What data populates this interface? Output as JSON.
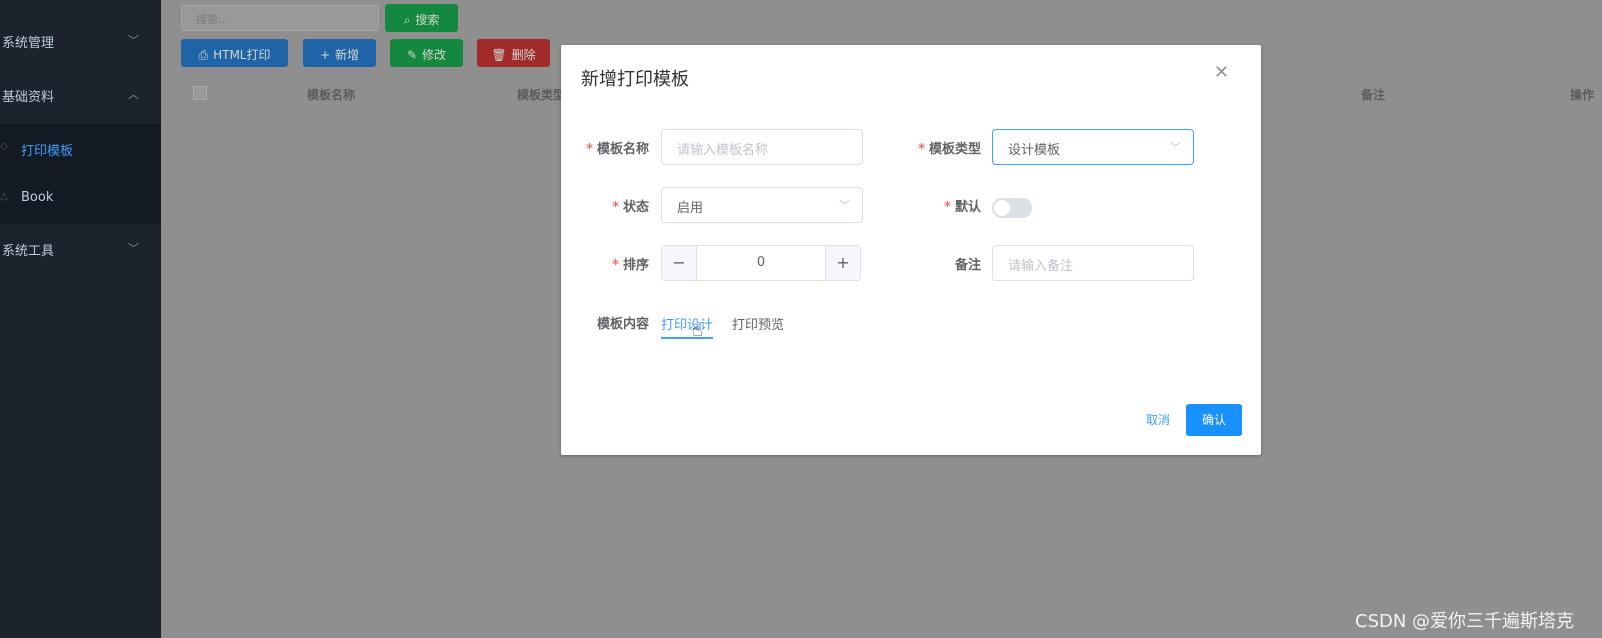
{
  "sidebar": {
    "groups": [
      {
        "label": "系统管理",
        "chevron": "chevron-down"
      },
      {
        "label": "基础资料",
        "chevron": "chevron-up"
      },
      {
        "label": "系统工具",
        "chevron": "chevron-down"
      }
    ],
    "items": [
      {
        "label": "打印模板",
        "active": true
      },
      {
        "label": "Book",
        "active": false
      }
    ]
  },
  "toolbar": {
    "search_placeholder": "搜索...",
    "search_button": "搜索",
    "html_print": "HTML打印",
    "add": "新增",
    "edit": "修改",
    "delete": "删除"
  },
  "table": {
    "columns": [
      "模板名称",
      "模板类型",
      "备注",
      "操作"
    ]
  },
  "dialog": {
    "title": "新增打印模板",
    "fields": {
      "name": {
        "label": "模板名称",
        "placeholder": "请输入模板名称",
        "required": true
      },
      "type": {
        "label": "模板类型",
        "value": "设计模板",
        "required": true
      },
      "status": {
        "label": "状态",
        "value": "启用",
        "required": true
      },
      "default": {
        "label": "默认",
        "on": false,
        "required": true
      },
      "order": {
        "label": "排序",
        "value": "0",
        "required": true
      },
      "remark": {
        "label": "备注",
        "placeholder": "请输入备注",
        "required": false
      }
    },
    "content_label": "模板内容",
    "tabs": [
      "打印设计",
      "打印预览"
    ],
    "cancel": "取消",
    "confirm": "确认"
  },
  "colors": {
    "primary": "#409eff",
    "success": "#13ce66",
    "danger": "#ff4949",
    "sidebar_bg": "#304156"
  },
  "watermark": "CSDN @爱你三千遍斯塔克"
}
